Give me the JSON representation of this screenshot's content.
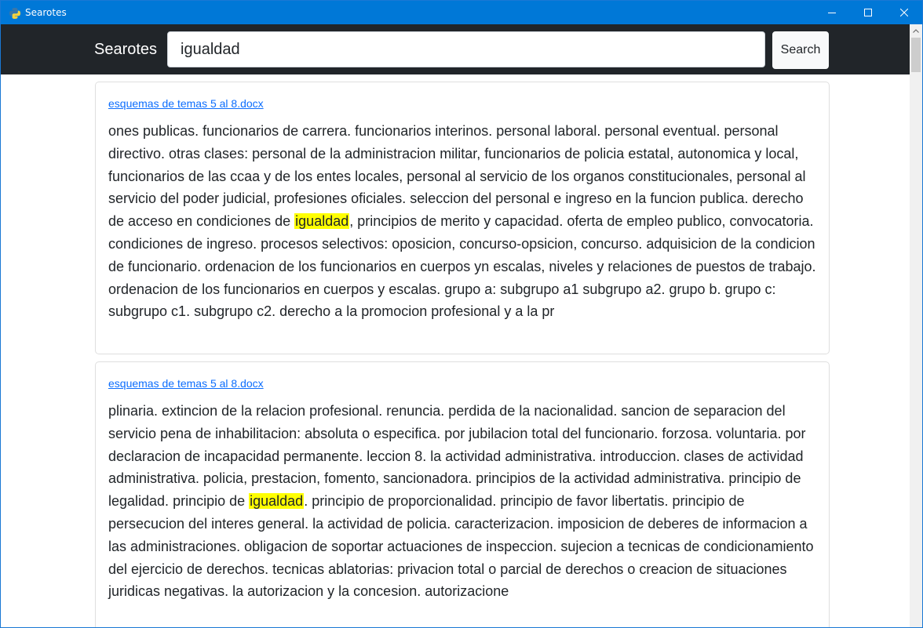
{
  "window": {
    "title": "Searotes",
    "icon": "python-icon",
    "controls": [
      "minimize-icon",
      "maximize-icon",
      "close-icon"
    ]
  },
  "navbar": {
    "brand": "Searotes",
    "search_value": "igualdad",
    "search_button": "Search"
  },
  "results": [
    {
      "file": "esquemas de temas 5 al 8.docx",
      "before": "ones publicas. funcionarios de carrera. funcionarios interinos. personal laboral. personal eventual. personal directivo. otras clases: personal de la administracion militar, funcionarios de policia estatal, autonomica y local, funcionarios de las ccaa y de los entes locales, personal al servicio de los organos constitucionales, personal al servicio del poder judicial, profesiones oficiales. seleccion del personal e ingreso en la funcion publica. derecho de acceso en condiciones de ",
      "match": "igualdad",
      "after": ", principios de merito y capacidad. oferta de empleo publico, convocatoria. condiciones de ingreso. procesos selectivos: oposicion, concurso-opsicion, concurso. adquisicion de la condicion de funcionario. ordenacion de los funcionarios en cuerpos yn escalas, niveles y relaciones de puestos de trabajo. ordenacion de los funcionarios en cuerpos y escalas. grupo a: subgrupo a1 subgrupo a2. grupo b. grupo c: subgrupo c1. subgrupo c2. derecho a la promocion profesional y a la pr"
    },
    {
      "file": "esquemas de temas 5 al 8.docx",
      "before": "plinaria. extincion de la relacion profesional. renuncia. perdida de la nacionalidad. sancion de separacion del servicio pena de inhabilitacion: absoluta o especifica. por jubilacion total del funcionario. forzosa. voluntaria. por declaracion de incapacidad permanente. leccion 8. la actividad administrativa. introduccion. clases de actividad administrativa. policia, prestacion, fomento, sancionadora. principios de la actividad administrativa. principio de legalidad. principio de ",
      "match": "igualdad",
      "after": ". principio de proporcionalidad. principio de favor libertatis. principio de persecucion del interes general. la actividad de policia. caracterizacion. imposicion de deberes de informacion a las administraciones. obligacion de soportar actuaciones de inspeccion. sujecion a tecnicas de condicionamiento del ejercicio de derechos. tecnicas ablatorias: privacion total o parcial de derechos o creacion de situaciones juridicas negativas. la autorizacion y la concesion. autorizacione"
    }
  ],
  "colors": {
    "titlebar": "#0078d7",
    "navbar": "#212529",
    "link": "#0d6efd",
    "highlight": "#ffff00"
  }
}
